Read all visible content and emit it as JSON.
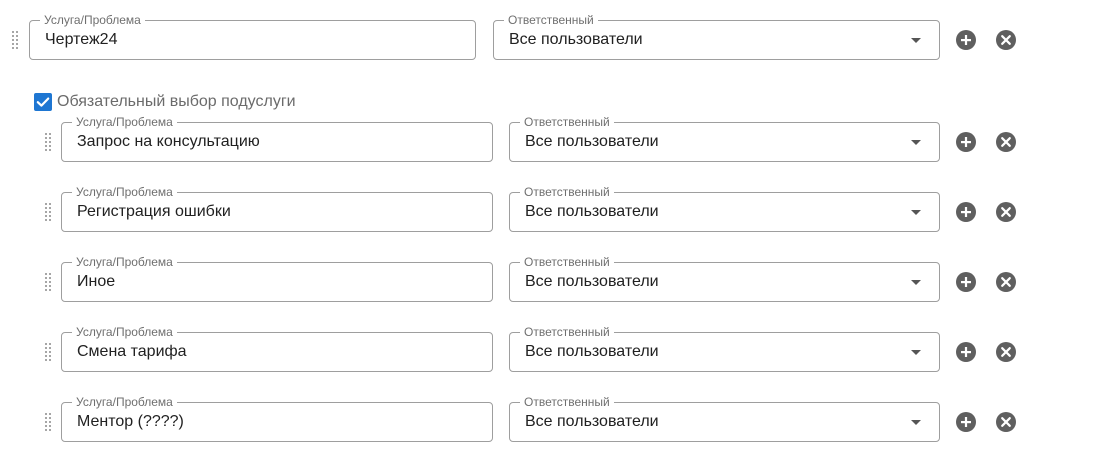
{
  "parent": {
    "service_label": "Услуга/Проблема",
    "service_value": "Чертеж24",
    "responsible_label": "Ответственный",
    "responsible_value": "Все пользователи"
  },
  "subservice_required": {
    "label": "Обязательный выбор подуслуги",
    "checked": true
  },
  "subservices": [
    {
      "service_label": "Услуга/Проблема",
      "service_value": "Запрос на консультацию",
      "responsible_label": "Ответственный",
      "responsible_value": "Все пользователи"
    },
    {
      "service_label": "Услуга/Проблема",
      "service_value": "Регистрация ошибки",
      "responsible_label": "Ответственный",
      "responsible_value": "Все пользователи"
    },
    {
      "service_label": "Услуга/Проблема",
      "service_value": "Иное",
      "responsible_label": "Ответственный",
      "responsible_value": "Все пользователи"
    },
    {
      "service_label": "Услуга/Проблема",
      "service_value": "Смена тарифа",
      "responsible_label": "Ответственный",
      "responsible_value": "Все пользователи"
    },
    {
      "service_label": "Услуга/Проблема",
      "service_value": "Ментор (????)",
      "responsible_label": "Ответственный",
      "responsible_value": "Все пользователи"
    }
  ],
  "icons": {
    "drag": "drag-handle-icon",
    "add": "add-circle-icon",
    "remove": "remove-circle-icon",
    "dropdown": "dropdown-caret-icon",
    "checkbox": "checkbox-checked-icon"
  },
  "colors": {
    "accent": "#1e76d2",
    "icon": "#5f5f5f",
    "border": "#9e9e9e"
  }
}
